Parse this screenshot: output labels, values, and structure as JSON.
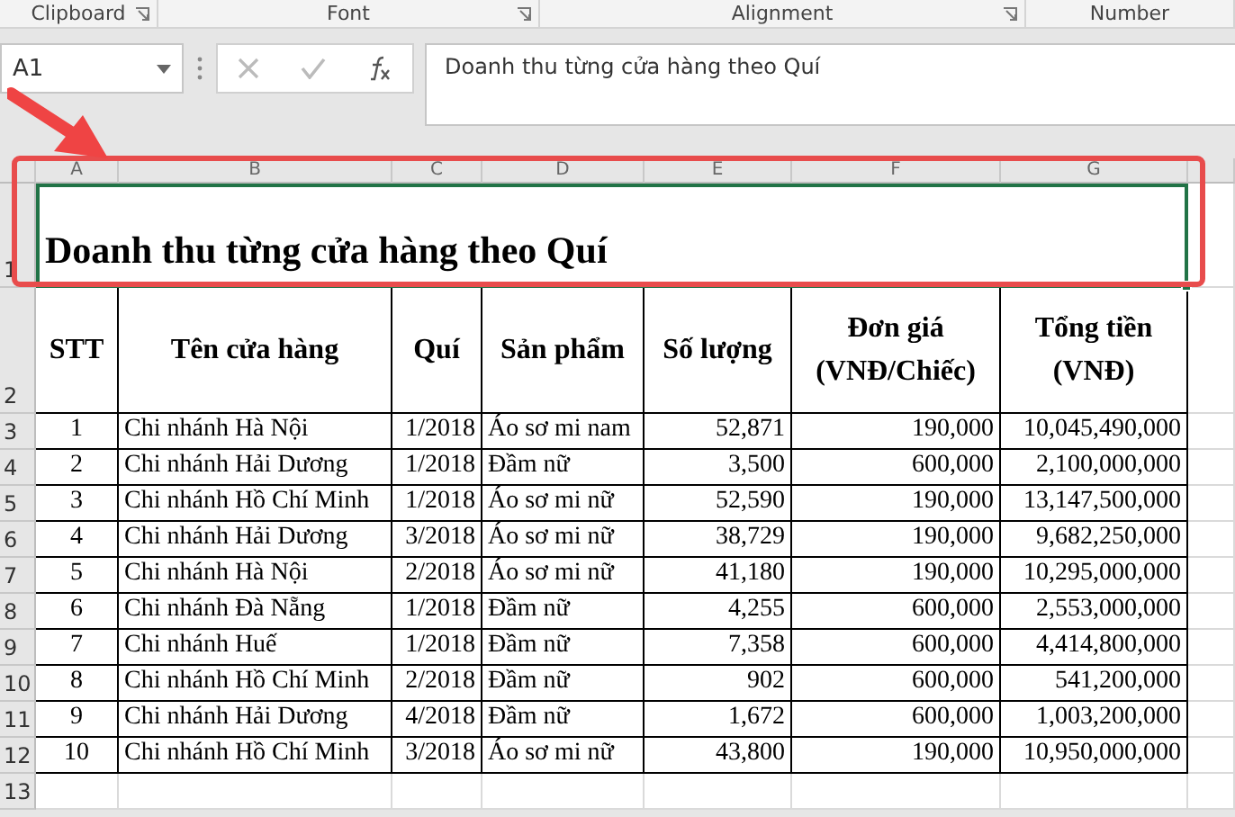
{
  "ribbon_groups": [
    {
      "label": "Clipboard"
    },
    {
      "label": "Font"
    },
    {
      "label": "Alignment"
    },
    {
      "label": "Number"
    }
  ],
  "name_box": "A1",
  "formula": "Doanh thu từng cửa hàng theo Quí",
  "columns": [
    "A",
    "B",
    "C",
    "D",
    "E",
    "F",
    "G"
  ],
  "rows": [
    {
      "number": "1",
      "kind": "title",
      "selected": true,
      "cells": [
        "Doanh thu từng cửa hàng theo Quí"
      ]
    },
    {
      "number": "2",
      "kind": "header",
      "cells": [
        "STT",
        "Tên cửa hàng",
        "Quí",
        "Sản phẩm",
        "Số lượng",
        "Đơn giá (VNĐ/Chiếc)",
        "Tổng tiền (VNĐ)"
      ]
    },
    {
      "number": "3",
      "kind": "data",
      "cells": [
        "1",
        "Chi nhánh Hà Nội",
        "1/2018",
        "Áo sơ mi nam",
        "52,871",
        "190,000",
        "10,045,490,000"
      ]
    },
    {
      "number": "4",
      "kind": "data",
      "cells": [
        "2",
        "Chi nhánh Hải Dương",
        "1/2018",
        "Đầm nữ",
        "3,500",
        "600,000",
        "2,100,000,000"
      ]
    },
    {
      "number": "5",
      "kind": "data",
      "cells": [
        "3",
        "Chi nhánh Hồ Chí Minh",
        "1/2018",
        "Áo sơ mi nữ",
        "52,590",
        "190,000",
        "13,147,500,000"
      ]
    },
    {
      "number": "6",
      "kind": "data",
      "cells": [
        "4",
        "Chi nhánh Hải Dương",
        "3/2018",
        "Áo sơ mi nữ",
        "38,729",
        "190,000",
        "9,682,250,000"
      ]
    },
    {
      "number": "7",
      "kind": "data",
      "cells": [
        "5",
        "Chi nhánh Hà Nội",
        "2/2018",
        "Áo sơ mi nữ",
        "41,180",
        "190,000",
        "10,295,000,000"
      ]
    },
    {
      "number": "8",
      "kind": "data",
      "cells": [
        "6",
        "Chi nhánh Đà Nẵng",
        "1/2018",
        "Đầm nữ",
        "4,255",
        "600,000",
        "2,553,000,000"
      ]
    },
    {
      "number": "9",
      "kind": "data",
      "cells": [
        "7",
        "Chi nhánh Huế",
        "1/2018",
        "Đầm nữ",
        "7,358",
        "600,000",
        "4,414,800,000"
      ]
    },
    {
      "number": "10",
      "kind": "data",
      "cells": [
        "8",
        "Chi nhánh Hồ Chí Minh",
        "2/2018",
        "Đầm nữ",
        "902",
        "600,000",
        "541,200,000"
      ]
    },
    {
      "number": "11",
      "kind": "data",
      "cells": [
        "9",
        "Chi nhánh Hải Dương",
        "4/2018",
        "Đầm nữ",
        "1,672",
        "600,000",
        "1,003,200,000"
      ]
    },
    {
      "number": "12",
      "kind": "data",
      "cells": [
        "10",
        "Chi nhánh Hồ Chí Minh",
        "3/2018",
        "Áo sơ mi nữ",
        "43,800",
        "190,000",
        "10,950,000,000"
      ]
    },
    {
      "number": "13",
      "kind": "empty",
      "cells": []
    }
  ]
}
